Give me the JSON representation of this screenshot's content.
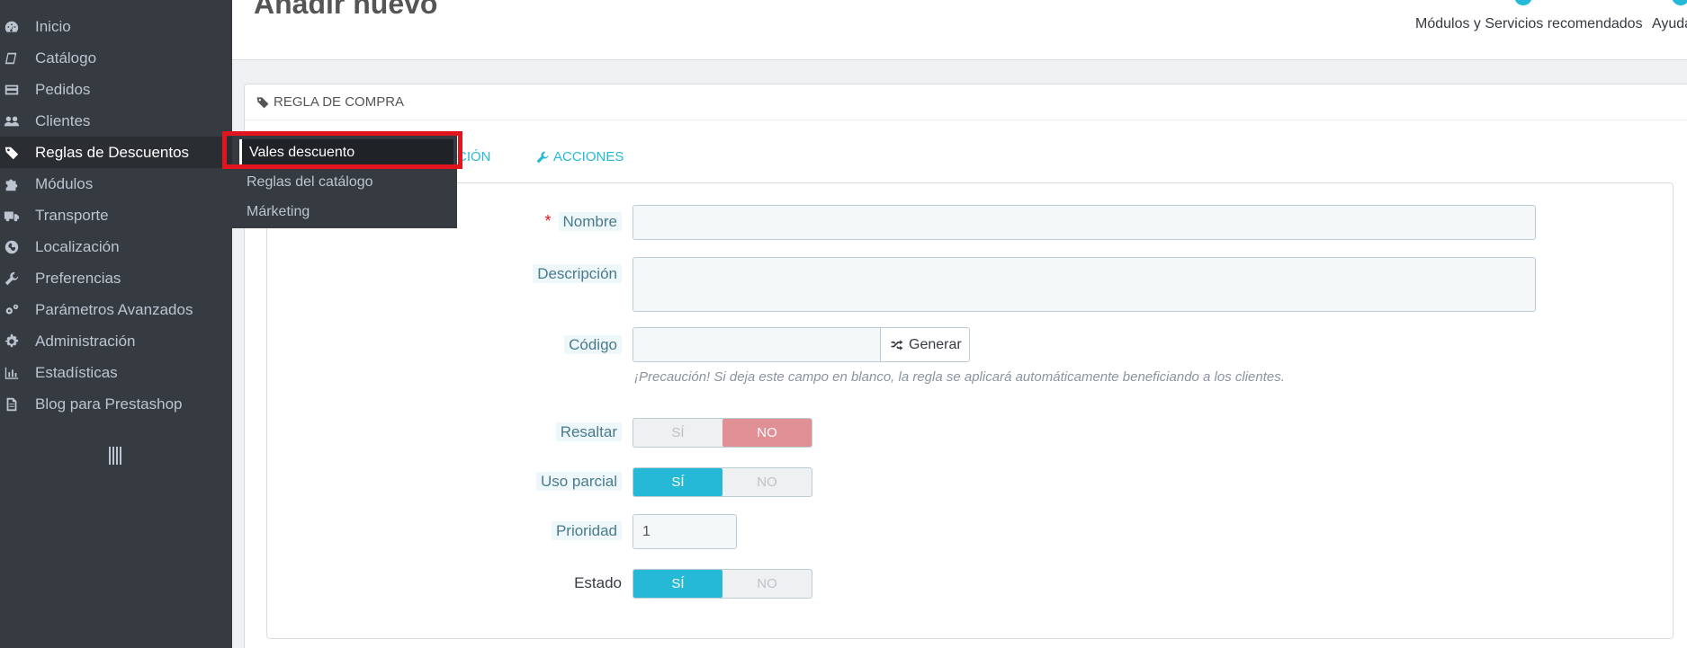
{
  "sidebar": {
    "items": [
      {
        "label": "Inicio",
        "icon": "dashboard-icon"
      },
      {
        "label": "Catálogo",
        "icon": "book-icon"
      },
      {
        "label": "Pedidos",
        "icon": "credit-card-icon"
      },
      {
        "label": "Clientes",
        "icon": "users-icon"
      },
      {
        "label": "Reglas de Descuentos",
        "icon": "tags-icon",
        "active": true
      },
      {
        "label": "Módulos",
        "icon": "puzzle-icon"
      },
      {
        "label": "Transporte",
        "icon": "truck-icon"
      },
      {
        "label": "Localización",
        "icon": "globe-icon"
      },
      {
        "label": "Preferencias",
        "icon": "wrench-icon"
      },
      {
        "label": "Parámetros Avanzados",
        "icon": "cogs-icon"
      },
      {
        "label": "Administración",
        "icon": "cog-icon"
      },
      {
        "label": "Estadísticas",
        "icon": "bar-chart-icon"
      },
      {
        "label": "Blog para Prestashop",
        "icon": "file-icon"
      }
    ],
    "collapse_icon": "collapse-toggle-icon"
  },
  "submenu": {
    "items": [
      {
        "label": "Vales descuento",
        "active": true
      },
      {
        "label": "Reglas del catálogo"
      },
      {
        "label": "Márketing"
      }
    ]
  },
  "header": {
    "title": "Añadir nuevo",
    "toolbar": {
      "modules_label": "Módulos y Servicios recomendados",
      "help_label": "Ayuda"
    }
  },
  "panel": {
    "heading": "REGLA DE COMPRA",
    "tabs": [
      {
        "label": "CIÓN"
      },
      {
        "label": "ACCIONES"
      }
    ]
  },
  "form": {
    "name": {
      "label": "Nombre",
      "required": "*",
      "value": ""
    },
    "description": {
      "label": "Descripción",
      "value": ""
    },
    "code": {
      "label": "Código",
      "value": "",
      "generate_label": "Generar",
      "help": "¡Precaución! Si deja este campo en blanco, la regla se aplicará automáticamente beneficiando a los clientes."
    },
    "highlight": {
      "label": "Resaltar",
      "yes": "SÍ",
      "no": "NO",
      "selected": "no"
    },
    "partial_use": {
      "label": "Uso parcial",
      "yes": "SÍ",
      "no": "NO",
      "selected": "yes"
    },
    "priority": {
      "label": "Prioridad",
      "value": "1"
    },
    "status": {
      "label": "Estado",
      "yes": "SÍ",
      "no": "NO",
      "selected": "yes"
    }
  },
  "colors": {
    "sidebar_bg": "#363a41",
    "accent": "#25b9d7",
    "switch_no": "#e08f95",
    "highlight_box": "#e2141d"
  }
}
